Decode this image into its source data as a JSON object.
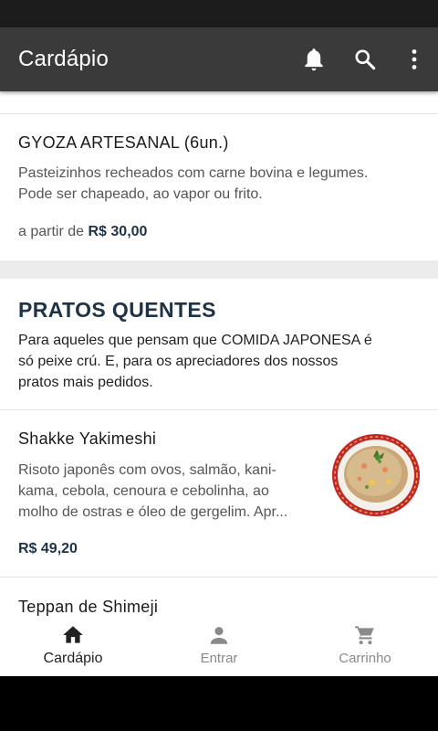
{
  "app_bar": {
    "title": "Cardápio",
    "icons": [
      "bell-icon",
      "search-icon",
      "more-vert-icon"
    ]
  },
  "items": [
    {
      "title": "GYOZA ARTESANAL (6un.)",
      "desc_line1": "Pasteizinhos recheados com carne bovina e legumes.",
      "desc_line2": "Pode ser chapeado, ao vapor ou frito.",
      "price_prefix": "a partir de",
      "price": "R$ 30,00"
    },
    {
      "title": "Shakke Yakimeshi",
      "desc_line1": "Risoto japonês com ovos, salmão, kani-",
      "desc_line2": "kama, cebola, cenoura e cebolinha, ao",
      "desc_line3": "molho de ostras e óleo de gergelim. Apr...",
      "price": "R$ 49,20"
    },
    {
      "title": "Teppan de Shimeji"
    }
  ],
  "section": {
    "title": "PRATOS QUENTES",
    "desc_line1": "Para aqueles que pensam que COMIDA JAPONESA é",
    "desc_line2": "só peixe crú. E, para os apreciadores dos nossos",
    "desc_line3": "pratos mais pedidos."
  },
  "bottom_nav": [
    {
      "label": "Cardápio",
      "icon": "home-icon",
      "active": true
    },
    {
      "label": "Entrar",
      "icon": "person-icon",
      "active": false
    },
    {
      "label": "Carrinho",
      "icon": "cart-icon",
      "active": false
    }
  ],
  "colors": {
    "app_bar": "#3a3a3a",
    "accent": "#1f3347",
    "nav_inactive": "#8a8a8a"
  }
}
